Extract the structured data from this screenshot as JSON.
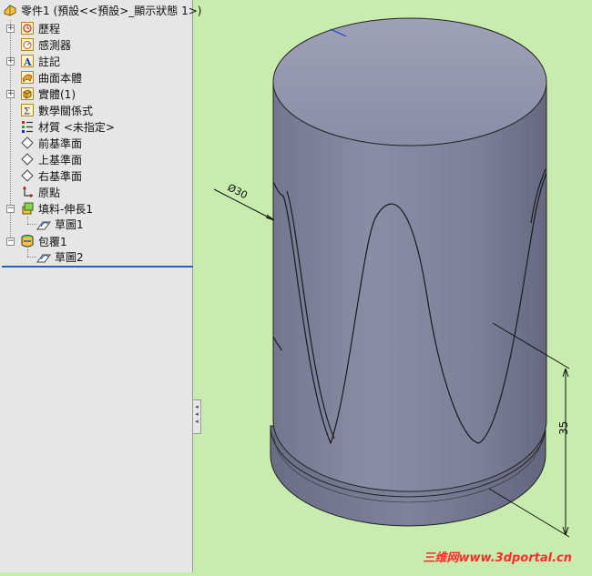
{
  "tree": {
    "root_label": "零件1  (預設<<預設>_顯示狀態 1>)",
    "items": [
      {
        "label": "歷程"
      },
      {
        "label": "感測器"
      },
      {
        "label": "註記"
      },
      {
        "label": "曲面本體"
      },
      {
        "label": "實體(1)"
      },
      {
        "label": "數學關係式"
      },
      {
        "label": "材質 <未指定>"
      },
      {
        "label": "前基準面"
      },
      {
        "label": "上基準面"
      },
      {
        "label": "右基準面"
      },
      {
        "label": "原點"
      },
      {
        "label": "填料-伸長1"
      },
      {
        "label": "草圖1"
      },
      {
        "label": "包覆1"
      },
      {
        "label": "草圖2"
      }
    ]
  },
  "dimensions": {
    "diameter": "Ø30",
    "height": "35"
  },
  "watermark": "三维网www.3dportal.cn",
  "colors": {
    "viewport_bg": "#c8ecae",
    "tree_bg": "#e6e6e6",
    "model_body": "#7c7f98",
    "rollback_bar": "#2a5fb5"
  }
}
